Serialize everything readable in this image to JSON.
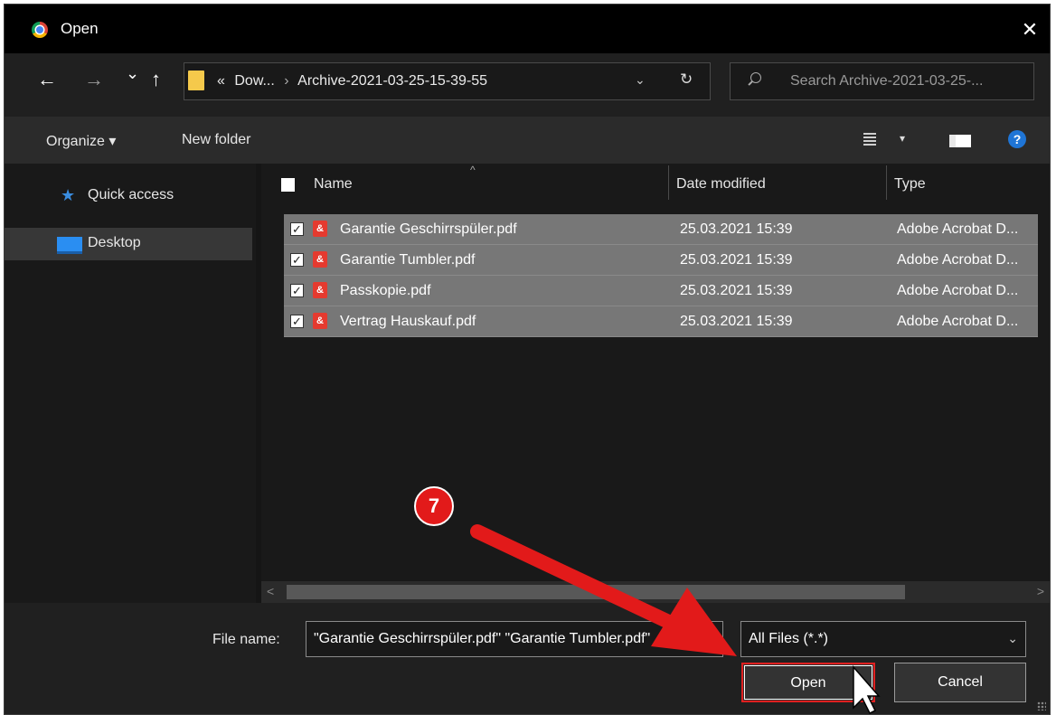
{
  "window": {
    "title": "Open",
    "close_label": "✕"
  },
  "nav": {
    "back": "←",
    "forward": "→",
    "recent": "⌄",
    "up": "↑"
  },
  "address": {
    "overflow": "«",
    "crumbs": [
      "Dow...",
      "Archive-2021-03-25-15-39-55"
    ],
    "separator": "›",
    "dropdown": "⌄",
    "refresh": "↻"
  },
  "search": {
    "placeholder": "Search Archive-2021-03-25-..."
  },
  "toolbar": {
    "organize_label": "Organize ▾",
    "new_folder_label": "New folder",
    "help_label": "?",
    "view_dropdown": "▾"
  },
  "sidebar": {
    "items": [
      {
        "label": "Quick access",
        "icon": "star-icon",
        "selected": false
      },
      {
        "label": "Desktop",
        "icon": "desktop-icon",
        "selected": true
      }
    ]
  },
  "file_list": {
    "columns": {
      "name": "Name",
      "date": "Date modified",
      "type": "Type"
    },
    "sort_indicator": "^",
    "rows": [
      {
        "name": "Garantie Geschirrspüler.pdf",
        "date": "25.03.2021 15:39",
        "type": "Adobe Acrobat D...",
        "checked": true
      },
      {
        "name": "Garantie Tumbler.pdf",
        "date": "25.03.2021 15:39",
        "type": "Adobe Acrobat D...",
        "checked": true
      },
      {
        "name": "Passkopie.pdf",
        "date": "25.03.2021 15:39",
        "type": "Adobe Acrobat D...",
        "checked": true
      },
      {
        "name": "Vertrag Hauskauf.pdf",
        "date": "25.03.2021 15:39",
        "type": "Adobe Acrobat D...",
        "checked": true
      }
    ]
  },
  "scrollbar": {
    "left_arrow": "<",
    "right_arrow": ">"
  },
  "bottom": {
    "file_name_label": "File name:",
    "file_name_value": "\"Garantie Geschirrspüler.pdf\" \"Garantie Tumbler.pdf\"",
    "file_type_value": "All Files (*.*)",
    "dropdown": "⌄",
    "open_label": "Open",
    "cancel_label": "Cancel"
  },
  "annotation": {
    "step_number": "7",
    "color": "#e21a1a"
  },
  "colors": {
    "dialog_bg": "#202020",
    "titlebar": "#000000",
    "selected_row": "#777777",
    "accent": "#1f75d6"
  }
}
